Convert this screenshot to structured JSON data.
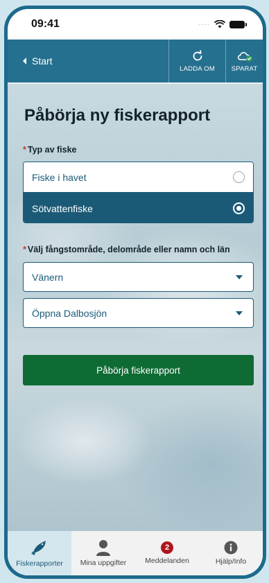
{
  "status_bar": {
    "time": "09:41"
  },
  "header": {
    "back_label": "Start",
    "reload_label": "LADDA OM",
    "saved_label": "SPARAT"
  },
  "main": {
    "title": "Påbörja ny fiskerapport",
    "fishing_type": {
      "required_marker": "*",
      "label": "Typ av fiske",
      "options": [
        {
          "label": "Fiske i havet",
          "selected": false
        },
        {
          "label": "Sötvattenfiske",
          "selected": true
        }
      ]
    },
    "area": {
      "required_marker": "*",
      "label": "Välj fångstområde, delområde eller namn och län",
      "select_1": "Vänern",
      "select_2": "Öppna Dalbosjön"
    },
    "start_button": "Påbörja fiskerapport"
  },
  "tabbar": {
    "items": [
      {
        "label": "Fiskerapporter",
        "icon": "fish-icon",
        "active": true
      },
      {
        "label": "Mina uppgifter",
        "icon": "person-icon",
        "active": false
      },
      {
        "label": "Meddelanden",
        "icon": "badge-icon",
        "badge": "2",
        "active": false
      },
      {
        "label": "Hjälp/Info",
        "icon": "info-icon",
        "active": false
      }
    ]
  },
  "colors": {
    "primary_blue": "#1b5a77",
    "header_blue": "#26708f",
    "primary_green": "#0f6b34",
    "badge_red": "#b0151c"
  }
}
